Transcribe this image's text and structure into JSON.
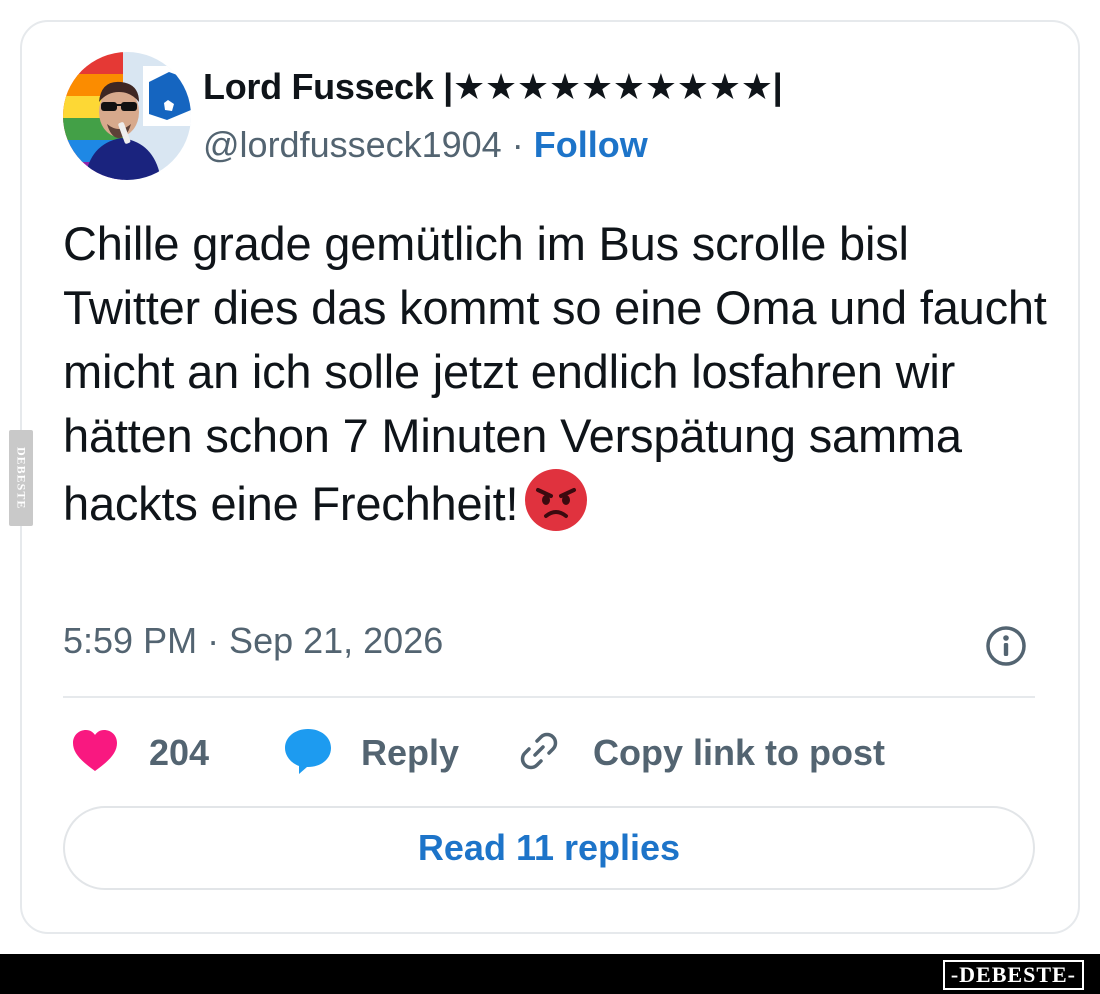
{
  "tweet": {
    "author_name": "Lord Fusseck |★★★★★★★★★★|",
    "handle": "@lordfusseck1904",
    "separator": "·",
    "follow_label": "Follow",
    "text": "Chille grade gemütlich im Bus scrolle bisl Twitter dies das kommt so eine Oma und faucht micht an ich solle jetzt endlich losfahren wir hätten schon 7 Minuten Verspätung samma hackts eine Frechheit!",
    "emoji": "angry-face-emoji",
    "timestamp": "5:59 PM · Sep 21, 2026"
  },
  "actions": {
    "like_count": "204",
    "reply_label": "Reply",
    "copy_label": "Copy link to post"
  },
  "read_replies_label": "Read 11 replies",
  "watermark": {
    "side": "DEBESTE",
    "bottom": "-DEBESTE-"
  },
  "colors": {
    "link_blue": "#1d74c9",
    "like_pink": "#f91880",
    "reply_blue": "#1d9bf0",
    "muted_gray": "#536471"
  }
}
